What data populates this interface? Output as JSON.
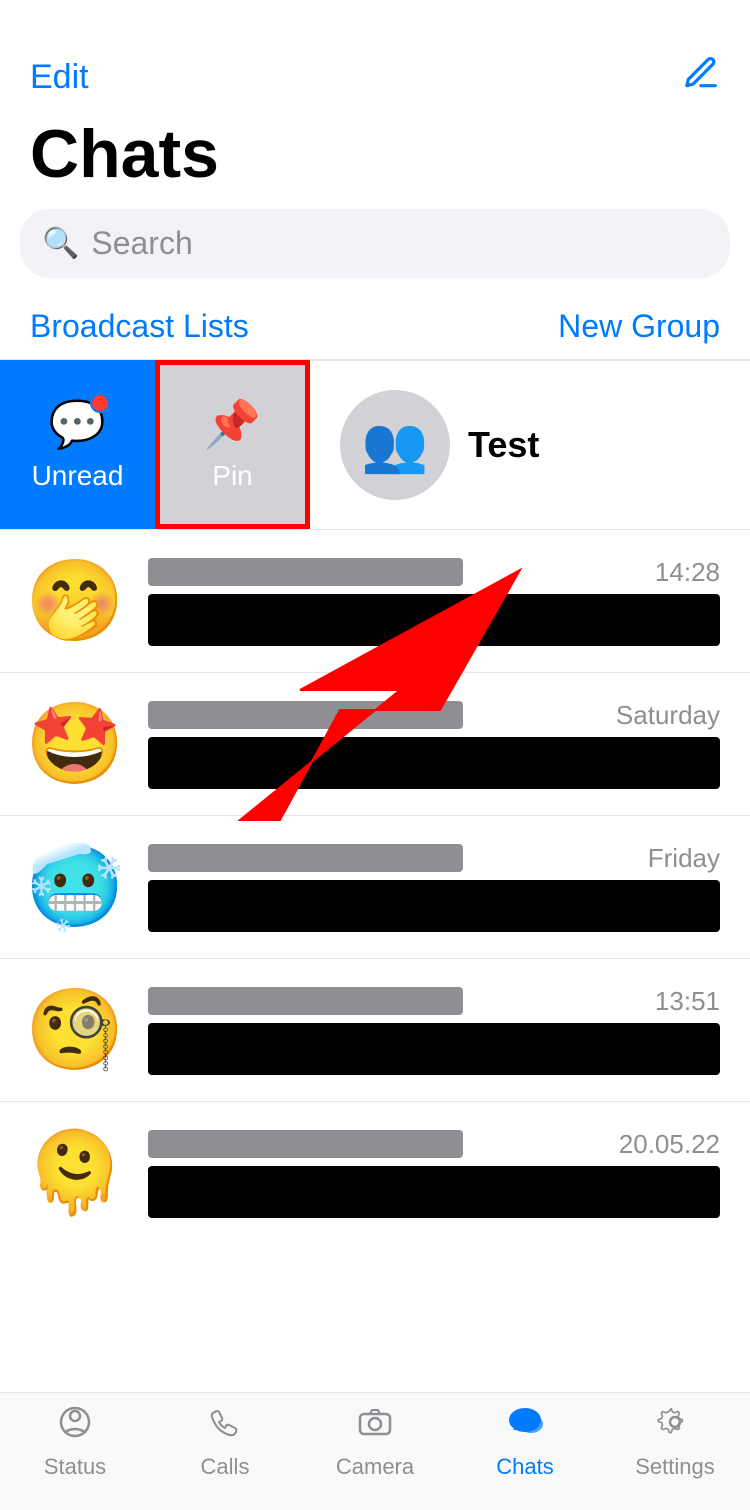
{
  "header": {
    "edit_label": "Edit",
    "title": "Chats",
    "compose_icon": "compose-icon"
  },
  "search": {
    "placeholder": "Search"
  },
  "actions": {
    "broadcast_label": "Broadcast Lists",
    "new_group_label": "New Group"
  },
  "filters": {
    "unread_label": "Unread",
    "pin_label": "Pin"
  },
  "test_group": {
    "name": "Test"
  },
  "chats": [
    {
      "emoji": "🤭",
      "time": "14:28"
    },
    {
      "emoji": "🤩",
      "time": "Saturday"
    },
    {
      "emoji": "🥶",
      "time": "Friday"
    },
    {
      "emoji": "🧐",
      "time": "13:51"
    },
    {
      "emoji": "🫠",
      "time": "20.05.22"
    }
  ],
  "tabs": [
    {
      "label": "Status",
      "icon": "status-icon",
      "active": false
    },
    {
      "label": "Calls",
      "icon": "calls-icon",
      "active": false
    },
    {
      "label": "Camera",
      "icon": "camera-icon",
      "active": false
    },
    {
      "label": "Chats",
      "icon": "chats-icon",
      "active": true
    },
    {
      "label": "Settings",
      "icon": "settings-icon",
      "active": false
    }
  ]
}
